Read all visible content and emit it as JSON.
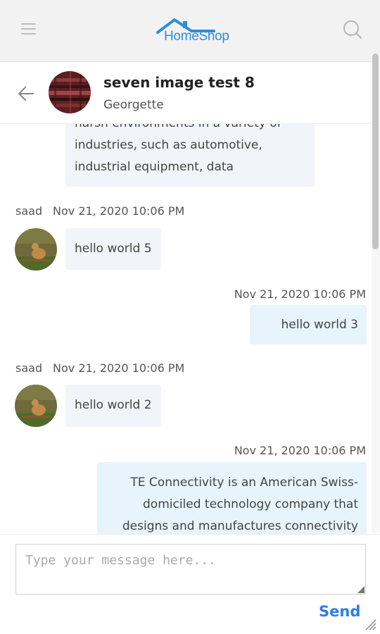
{
  "app": {
    "logo_text": "HomeShop",
    "brand_color": "#2e8ddb",
    "icons": {
      "menu": "hamburger-menu-icon",
      "search": "search-icon",
      "back": "back-arrow-icon"
    }
  },
  "conversation": {
    "title": "seven image test 8",
    "subtitle": "Georgette"
  },
  "messages": [
    {
      "direction": "incoming",
      "lines": [
        "harsh environments in a variety of",
        "industries, such as automotive,",
        "industrial equipment, data"
      ]
    },
    {
      "direction": "incoming",
      "sender": "saad",
      "timestamp": "Nov 21, 2020 10:06 PM",
      "lines": [
        "hello world 5"
      ]
    },
    {
      "direction": "outgoing",
      "timestamp": "Nov 21, 2020 10:06 PM",
      "lines": [
        "hello world 3"
      ]
    },
    {
      "direction": "incoming",
      "sender": "saad",
      "timestamp": "Nov 21, 2020 10:06 PM",
      "lines": [
        "hello world 2"
      ]
    },
    {
      "direction": "outgoing",
      "timestamp": "Nov 21, 2020 10:06 PM",
      "lines": [
        "TE Connectivity is an American Swiss-",
        "domiciled technology company that",
        "designs and manufactures connectivity"
      ]
    }
  ],
  "composer": {
    "placeholder": "Type your message here...",
    "value": "",
    "send_label": "Send",
    "send_color": "#2d7ee6"
  }
}
